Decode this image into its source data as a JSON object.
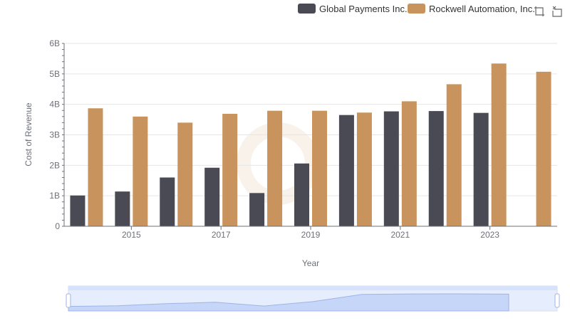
{
  "colors": {
    "global_payments": "#4a4a55",
    "rockwell": "#c9935e",
    "grid": "#e6e6e6",
    "axis": "#6e7079",
    "zoom_fill": "#d6e2fb",
    "zoom_stroke": "#9fb4e6"
  },
  "toolbar": {
    "zoom_icon": "zoom-icon",
    "reset_icon": "reset-icon"
  },
  "chart_data": {
    "type": "bar",
    "xlabel": "Year",
    "ylabel": "Cost of Revenue",
    "x_tick_labels": [
      "2015",
      "2017",
      "2019",
      "2021",
      "2023"
    ],
    "y_tick_labels": [
      "0",
      "1B",
      "2B",
      "3B",
      "4B",
      "5B",
      "6B"
    ],
    "ylim": [
      0,
      6000000000
    ],
    "categories": [
      "2014",
      "2015",
      "2016",
      "2017",
      "2018",
      "2019",
      "2020",
      "2021",
      "2022",
      "2023",
      "2024"
    ],
    "series": [
      {
        "name": "Global Payments Inc.",
        "color": "#4a4a55",
        "values": [
          1010000000,
          1140000000,
          1600000000,
          1920000000,
          1090000000,
          2060000000,
          3650000000,
          3770000000,
          3780000000,
          3720000000,
          null
        ]
      },
      {
        "name": "Rockwell Automation, Inc.",
        "color": "#c9935e",
        "values": [
          3870000000,
          3600000000,
          3400000000,
          3690000000,
          3790000000,
          3790000000,
          3730000000,
          4100000000,
          4660000000,
          5340000000,
          5070000000
        ]
      }
    ],
    "legend_position": "top-right",
    "grid": true
  }
}
